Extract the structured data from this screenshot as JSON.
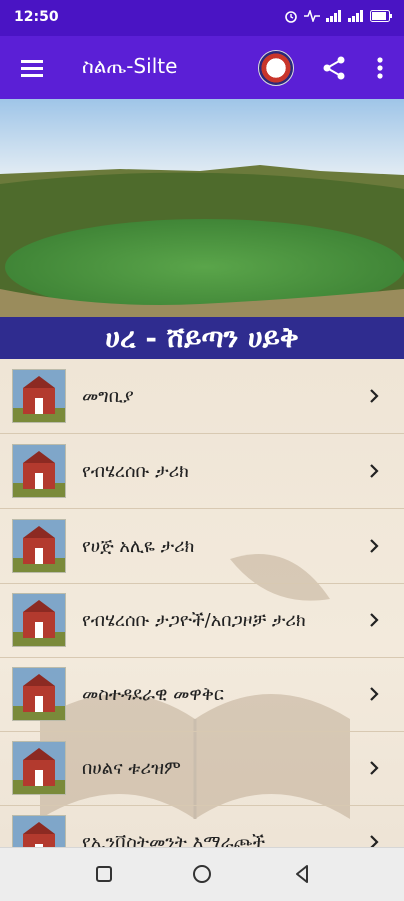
{
  "status_bar": {
    "time": "12:50"
  },
  "app_bar": {
    "title": "ስልጤ-Silte"
  },
  "heading": "ሀረ - ሸይጣን ሀይቅ",
  "items": [
    {
      "label": "መግቢያ"
    },
    {
      "label": "የብሄረሰቡ ታሪክ"
    },
    {
      "label": "የሀጅ አሊዬ ታሪክ"
    },
    {
      "label": "የብሄረሰቡ ታጋዮች/አበጋዞቻ ታሪክ"
    },
    {
      "label": "መስተዳደራዊ መዋቅር"
    },
    {
      "label": "በሀልና ቱሪዝም"
    },
    {
      "label": "የኢንቨስትመንት እማራጮች"
    }
  ],
  "colors": {
    "status_bar": "#4a14c4",
    "app_bar": "#5b1fd6",
    "heading_bg": "#2f2c8f"
  },
  "icons": [
    "hamburger-menu-icon",
    "logo-icon",
    "share-icon",
    "more-vertical-icon",
    "chevron-right-icon",
    "square-nav-icon",
    "circle-nav-icon",
    "back-triangle-icon"
  ]
}
